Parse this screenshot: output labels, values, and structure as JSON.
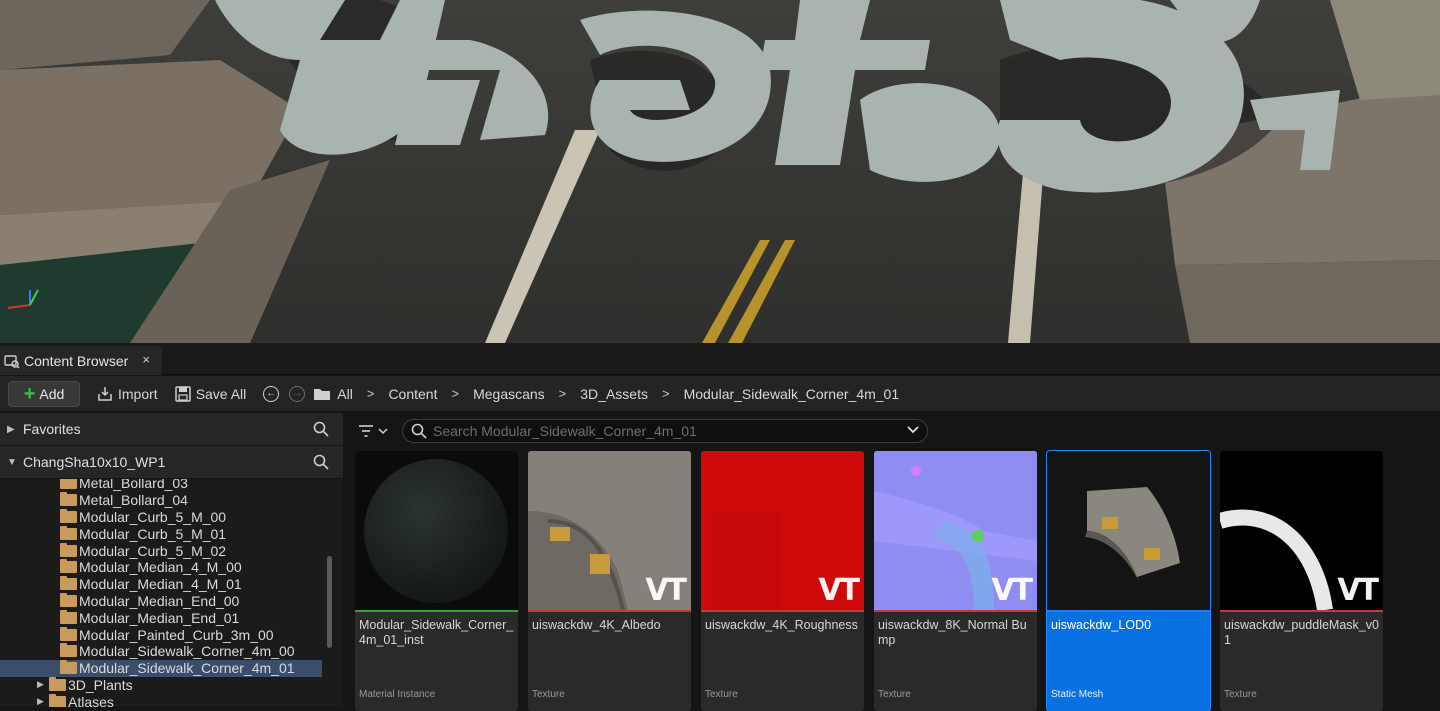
{
  "tab": {
    "label": "Content Browser",
    "close": "×"
  },
  "toolbar": {
    "add_label": "Add",
    "import_label": "Import",
    "save_all_label": "Save All",
    "breadcrumbs": [
      "All",
      "Content",
      "Megascans",
      "3D_Assets",
      "Modular_Sidewalk_Corner_4m_01"
    ]
  },
  "sidebar": {
    "favorites_label": "Favorites",
    "project_label": "ChangSha10x10_WP1",
    "folders": [
      "Metal_Bollard_03",
      "Metal_Bollard_04",
      "Modular_Curb_5_M_00",
      "Modular_Curb_5_M_01",
      "Modular_Curb_5_M_02",
      "Modular_Median_4_M_00",
      "Modular_Median_4_M_01",
      "Modular_Median_End_00",
      "Modular_Median_End_01",
      "Modular_Painted_Curb_3m_00",
      "Modular_Sidewalk_Corner_4m_00",
      "Modular_Sidewalk_Corner_4m_01"
    ],
    "parent_folders": [
      "3D_Plants",
      "Atlases"
    ]
  },
  "search": {
    "placeholder": "Search Modular_Sidewalk_Corner_4m_01"
  },
  "assets": [
    {
      "name": "Modular_Sidewalk_Corner_4m_01_inst",
      "type": "Material Instance",
      "bar_color": "#2fa52f",
      "vt": ""
    },
    {
      "name": "uiswackdw_4K_Albedo",
      "type": "Texture",
      "bar_color": "#c43a3a",
      "vt": "VT"
    },
    {
      "name": "uiswackdw_4K_Roughness",
      "type": "Texture",
      "bar_color": "#c43a3a",
      "vt": "VT"
    },
    {
      "name": "uiswackdw_8K_Normal Bump",
      "type": "Texture",
      "bar_color": "#c43a3a",
      "vt": "VT"
    },
    {
      "name": "uiswackdw_LOD0",
      "type": "Static Mesh",
      "bar_color": "#1f7cff",
      "vt": ""
    },
    {
      "name": "uiswackdw_puddleMask_v01",
      "type": "Texture",
      "bar_color": "#c43a3a",
      "vt": "VT"
    }
  ]
}
